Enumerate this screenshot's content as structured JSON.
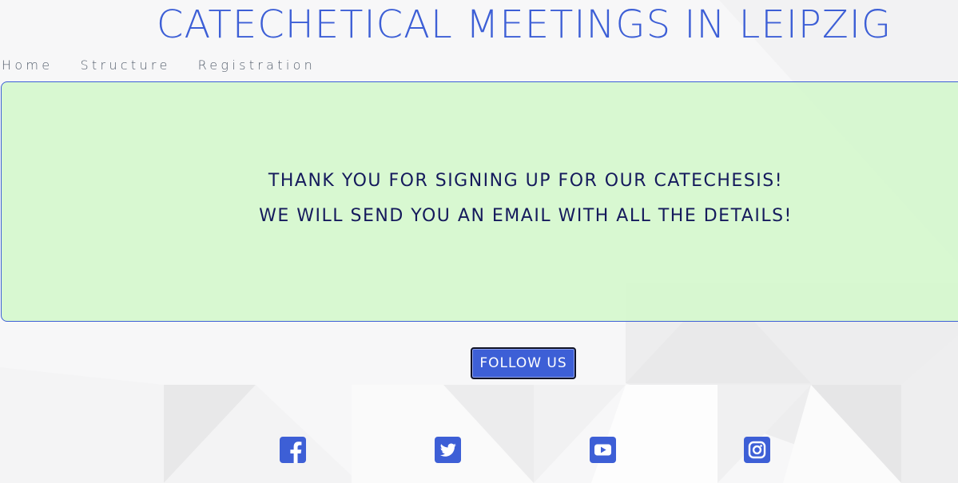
{
  "header": {
    "title": "CATECHETICAL MEETINGS IN LEIPZIG"
  },
  "nav": {
    "items": [
      {
        "label": "Home"
      },
      {
        "label": "Structure"
      },
      {
        "label": "Registration"
      }
    ]
  },
  "confirmation": {
    "line1": "THANK YOU FOR SIGNING UP FOR OUR CATECHESIS!",
    "line2": "WE WILL SEND YOU AN EMAIL WITH ALL THE DETAILS!"
  },
  "follow": {
    "button_label": "FOLLOW US"
  },
  "social": {
    "icons": [
      "facebook-icon",
      "twitter-icon",
      "youtube-icon",
      "instagram-icon"
    ]
  },
  "colors": {
    "accent": "#3d5fd6",
    "confirmation_bg": "#d5f8ce",
    "confirmation_text": "#151a5c",
    "nav_text": "#56606e"
  }
}
